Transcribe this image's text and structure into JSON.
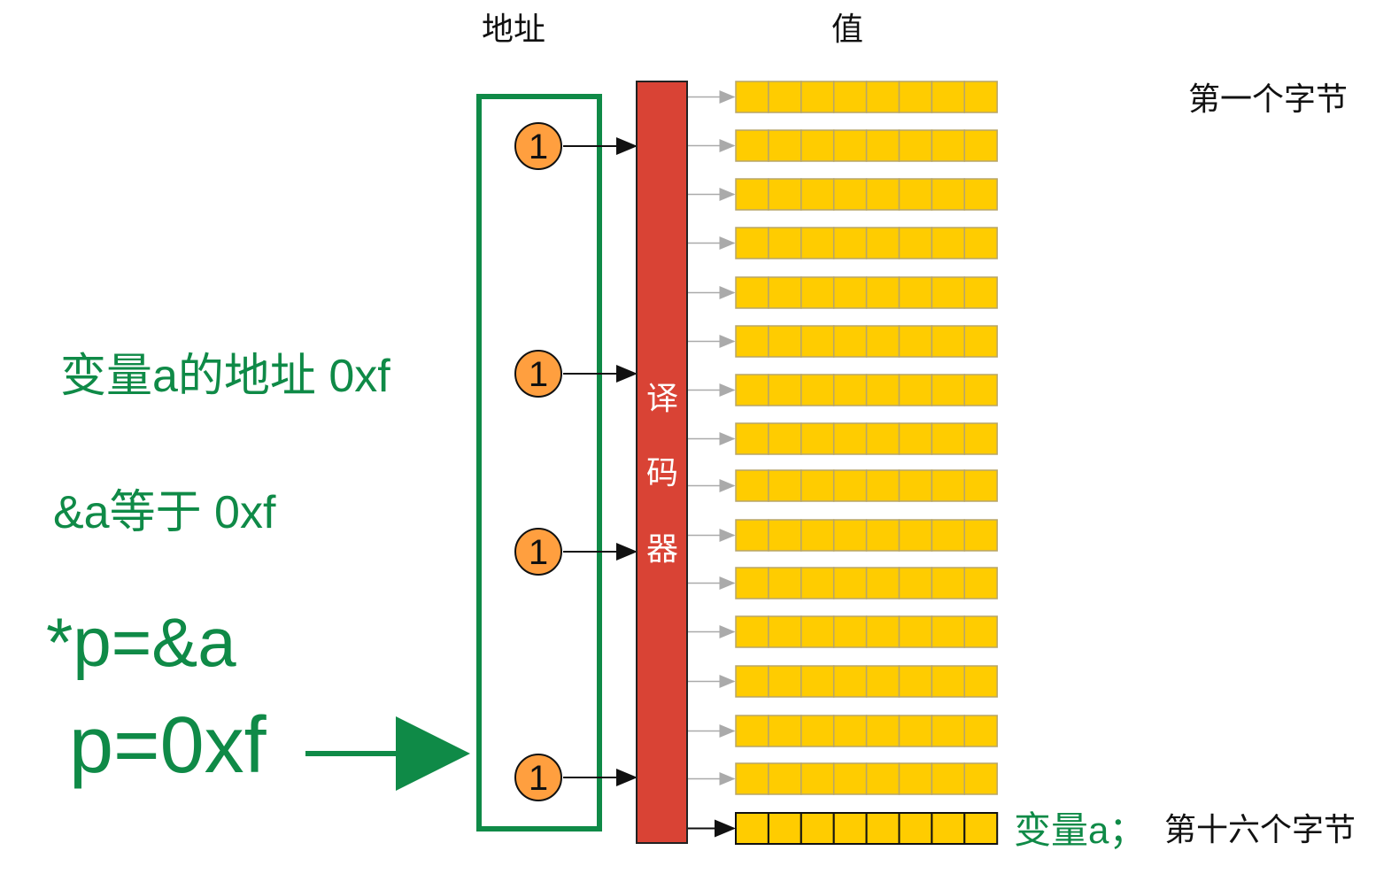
{
  "headers": {
    "address": "地址",
    "value": "值"
  },
  "labels": {
    "first_byte": "第一个字节",
    "variable_a": "变量a；",
    "sixteenth_byte": "第十六个字节",
    "decoder_chars": [
      "译",
      "码",
      "器"
    ]
  },
  "notes": {
    "address_of_a": "变量a的地址 0xf",
    "ampersand_a": "&a等于 0xf",
    "pointer_decl": "*p=&a",
    "pointer_value": "p=0xf"
  },
  "address_bits": [
    "1",
    "1",
    "1",
    "1"
  ],
  "memory": {
    "rows": 16,
    "bits_per_row": 8,
    "highlighted_row": 15
  },
  "colors": {
    "green": "#0f8a47",
    "decoder_red": "#d94335",
    "cell_yellow": "#ffcc00",
    "circle_orange": "#ff9f3f"
  }
}
